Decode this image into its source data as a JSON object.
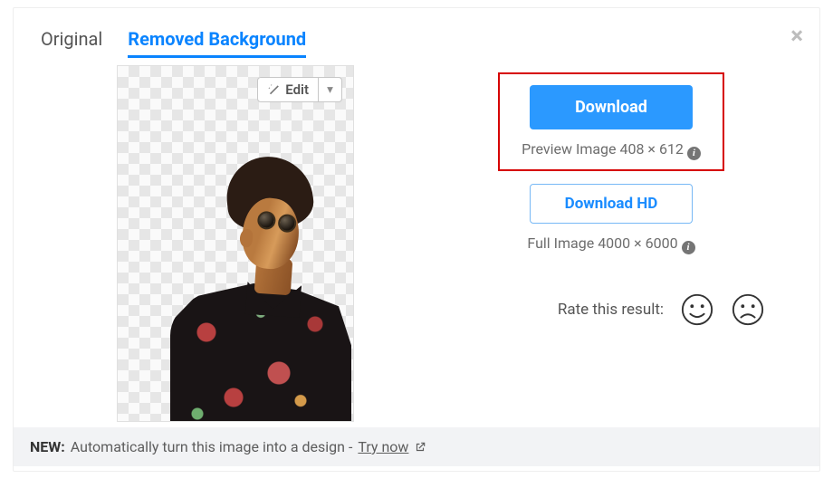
{
  "close_label": "×",
  "tabs": {
    "original": "Original",
    "removed": "Removed Background"
  },
  "edit": {
    "label": "Edit",
    "caret": "▾"
  },
  "download": {
    "primary": "Download",
    "preview_text": "Preview Image 408 × 612",
    "hd_label": "Download HD",
    "full_text": "Full Image 4000 × 6000"
  },
  "rate": {
    "label": "Rate this result:"
  },
  "footer": {
    "new": "NEW:",
    "text": "Automatically turn this image into a design -",
    "link": "Try now"
  }
}
